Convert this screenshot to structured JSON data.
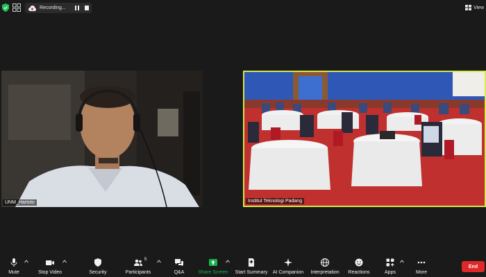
{
  "topbar": {
    "recording_label": "Recording...",
    "view_label": "View"
  },
  "tiles": [
    {
      "name": "UNM_Hartoto"
    },
    {
      "name": "Institut Teknologi Padang"
    }
  ],
  "toolbar": {
    "mute": "Mute",
    "stop_video": "Stop Video",
    "security": "Security",
    "participants": "Participants",
    "participants_count": "5",
    "qa": "Q&A",
    "share_screen": "Share Screen",
    "start_summary": "Start Summary",
    "ai_companion": "AI Companion",
    "interpretation": "Interpretation",
    "reactions": "Reactions",
    "apps": "Apps",
    "more": "More",
    "end": "End"
  },
  "colors": {
    "accent_share": "#17b34a",
    "end_red": "#e02828",
    "active_speaker_border": "#d8e94a"
  }
}
